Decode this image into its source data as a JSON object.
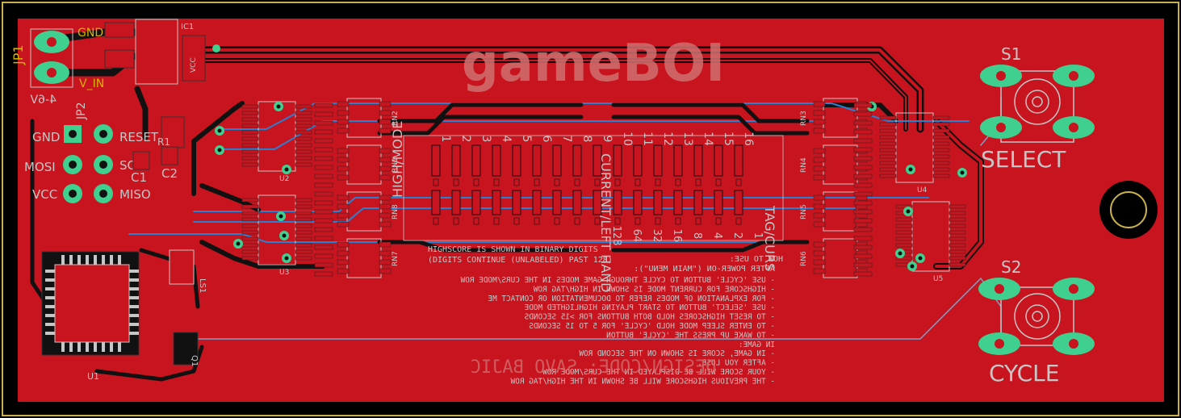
{
  "board": {
    "title": "gameBOI",
    "credit": "DESIGN/CODE: SAVO BAJIC",
    "colors": {
      "background": "#000000",
      "copper_top": "#c8141e",
      "copper_bottom": "#2a7fd0",
      "pad": "#3fcf8f",
      "silk": "#c6c6c6",
      "label": "#d6b300",
      "outline": "#c8b14b"
    },
    "power": {
      "ref": "JP1",
      "gnd": "GND",
      "vin": "V_IN",
      "vrange": "4-6V",
      "ic": "IC1",
      "vcc": "VCC"
    },
    "isp": {
      "ref": "JP2",
      "labels": [
        "GND",
        "MOSI",
        "VCC",
        "RESET",
        "SCK",
        "MISO"
      ]
    },
    "caps": [
      "C1",
      "C2"
    ],
    "resistor": "R1",
    "mcu": "U1",
    "drivers": {
      "left": [
        "U2",
        "U3"
      ],
      "right": [
        "U4",
        "U5"
      ]
    },
    "rn_left": [
      "RN2",
      "RN1",
      "RN8",
      "RN7"
    ],
    "rn_right": [
      "RN3",
      "RN4",
      "RN5",
      "RN6"
    ],
    "matrix": {
      "left_label": "HIGH/MODE",
      "center_label": "CURRENT/LEFT HAND",
      "right_label": "TAG/CURS",
      "top_digits": [
        "1",
        "2",
        "3",
        "4",
        "5",
        "6",
        "7",
        "8",
        "9",
        "10",
        "11",
        "12",
        "13",
        "14",
        "15",
        "16"
      ],
      "bottom_digits": [
        "128",
        "64",
        "32",
        "16",
        "8",
        "4",
        "2",
        "1"
      ],
      "note1": "HIGHSCORE IS SHOWN IN BINARY DIGITS",
      "note2": "(DIGITS CONTINUE (UNLABELED) PAST 128)",
      "note3": "AFTER POWER-ON (\"MAIN MENU\"):",
      "note4": "HOW TO USE:"
    },
    "instructions": [
      "- USE 'CYCLE' BUTTON TO CYCLE THROUGH GAME MODES IN THE CURS/MODE ROW",
      "- HIGHSCORE FOR CURRENT MODE IS SHOWN IN HIGH/TAG ROW",
      "- FOR EXPLANATION OF MODES REFER TO DOCUMENTATION OR CONTACT ME",
      "- USE 'SELECT' BUTTON TO START PLAYING HIGHLIGHTED MODE",
      "- TO RESET HIGHSCORES HOLD BOTH BUTTONS FOR >15 SECONDS",
      "- TO ENTER SLEEP MODE HOLD 'CYCLE' FOR 5 TO 15 SECONDS",
      "- TO WAKE UP PRESS THE 'CYCLE' BUTTON",
      "IN GAME:",
      "- IN GAME, SCORE IS SHOWN ON THE SECOND ROW",
      "- AFTER YOU LOSE,",
      "- YOUR SCORE WILL BE DISPLAYED IN THE CURS/MODE ROW",
      "- THE PREVIOUS HIGHSCORE WILL BE SHOWN IN THE HIGH/TAG ROW"
    ],
    "buttons": {
      "s1": {
        "ref": "S1",
        "label": "SELECT"
      },
      "s2": {
        "ref": "S2",
        "label": "CYCLE"
      }
    },
    "buzzer": "LS1",
    "crystal": "Q1"
  }
}
